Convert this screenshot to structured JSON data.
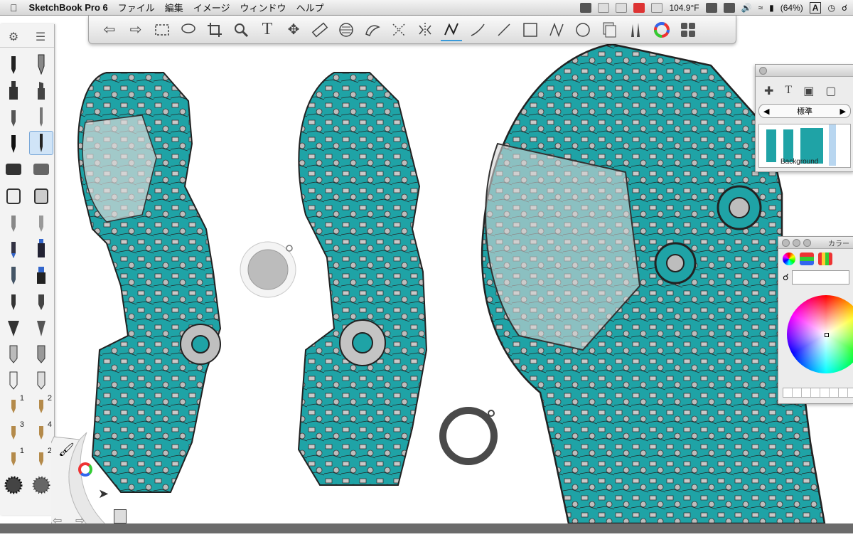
{
  "menubar": {
    "app_name": "SketchBook Pro 6",
    "menus": [
      "ファイル",
      "編集",
      "イメージ",
      "ウィンドウ",
      "ヘルプ"
    ],
    "temperature": "104.9°F",
    "battery": "(64%)",
    "input_source": "A"
  },
  "layer_editor": {
    "blend_mode": "標準",
    "layer_name": "Background"
  },
  "color_editor": {
    "title": "カラー"
  },
  "brushes": {
    "preset_numbers": [
      "1",
      "2",
      "3",
      "4",
      "1",
      "2"
    ]
  },
  "colors": {
    "accent_teal": "#1fa3a6",
    "menubar": "#e6e6e6",
    "selection_blue": "#3a9ad9"
  }
}
